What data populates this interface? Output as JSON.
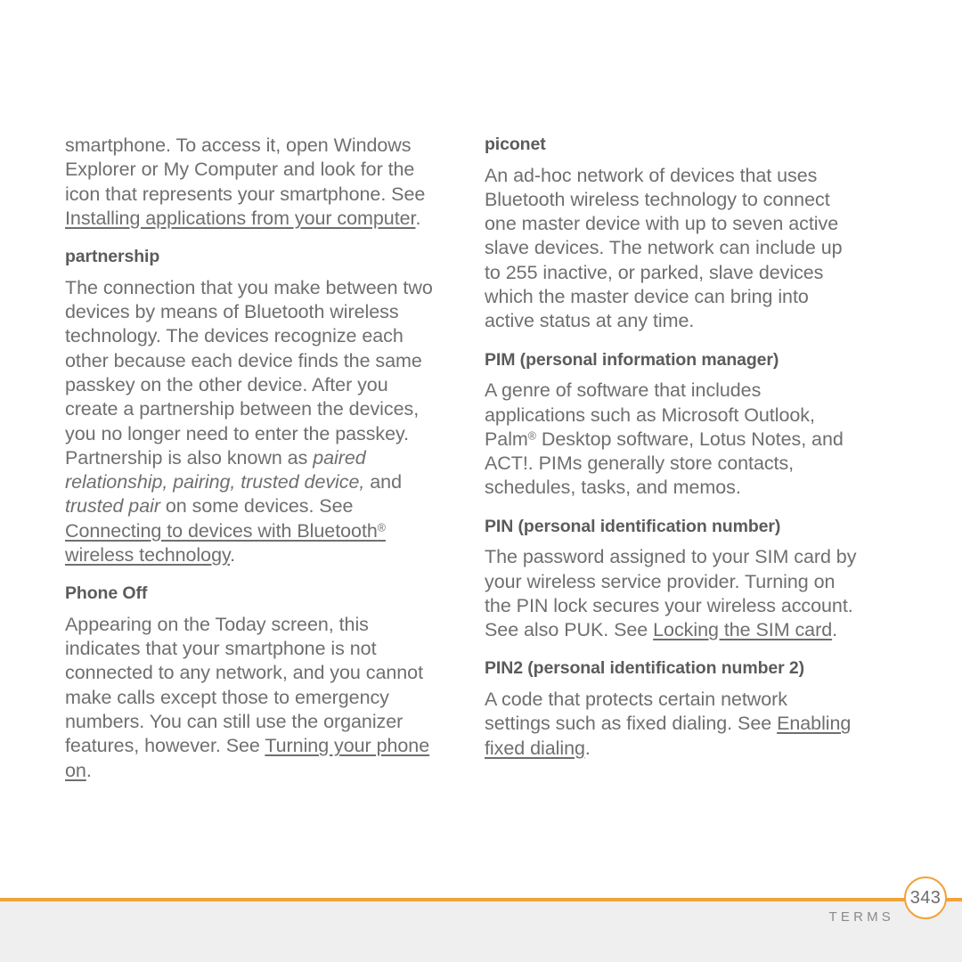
{
  "document": {
    "page_number": "343",
    "footer_label": "TERMS",
    "accent_color": "#f2a23a",
    "body_text_color": "#6f6f6f",
    "heading_text_color": "#5b5b5b",
    "footer_band_color": "#efefef"
  },
  "left_column": {
    "continued_paragraph": {
      "text_before_link": "smartphone. To access it, open Windows Explorer or My Computer and look for the icon that represents your smartphone. See ",
      "link": "Installing applications from your computer",
      "text_after_link": "."
    },
    "entries": [
      {
        "term": "partnership",
        "text_1": "The connection that you make between two devices by means of Bluetooth wireless technology. The devices recognize each other because each device finds the same passkey on the other device. After you create a partnership between the devices, you no longer need to enter the passkey. Partnership is also known as ",
        "italic_1": "paired relationship, pairing, trusted device,",
        "text_2": " and ",
        "italic_2": "trusted pair",
        "text_3": " on some devices. See ",
        "link": "Connecting to devices with Bluetooth® wireless technology",
        "link_part_1": "Connecting to devices with Bluetooth",
        "link_superscript": "®",
        "link_part_2": " wireless technology",
        "text_4": "."
      },
      {
        "term": "Phone Off",
        "text_1": "Appearing on the Today screen, this indicates that your smartphone is not connected to any network, and you cannot make calls except those to emergency numbers. You can still use the organizer features, however. See ",
        "link": "Turning your phone on",
        "text_2": "."
      }
    ]
  },
  "right_column": {
    "entries": [
      {
        "term": "piconet",
        "text_1": "An ad-hoc network of devices that uses Bluetooth wireless technology to connect one master device with up to seven active slave devices. The network can include up to 255 inactive, or parked, slave devices which the master device can bring into active status at any time."
      },
      {
        "term": "PIM (personal information manager)",
        "text_1": "A genre of software that includes applications such as Microsoft Outlook, Palm",
        "superscript": "®",
        "text_2": " Desktop software, Lotus Notes, and ACT!. PIMs generally store contacts, schedules, tasks, and memos."
      },
      {
        "term": "PIN (personal identification number)",
        "text_1": "The password assigned to your SIM card by your wireless service provider. Turning on the PIN lock secures your wireless account. See also PUK. See ",
        "link": "Locking the SIM card",
        "text_2": "."
      },
      {
        "term": "PIN2 (personal identification number 2)",
        "text_1": "A code that protects certain network settings such as fixed dialing. See ",
        "link": "Enabling fixed dialing",
        "text_2": "."
      }
    ]
  }
}
